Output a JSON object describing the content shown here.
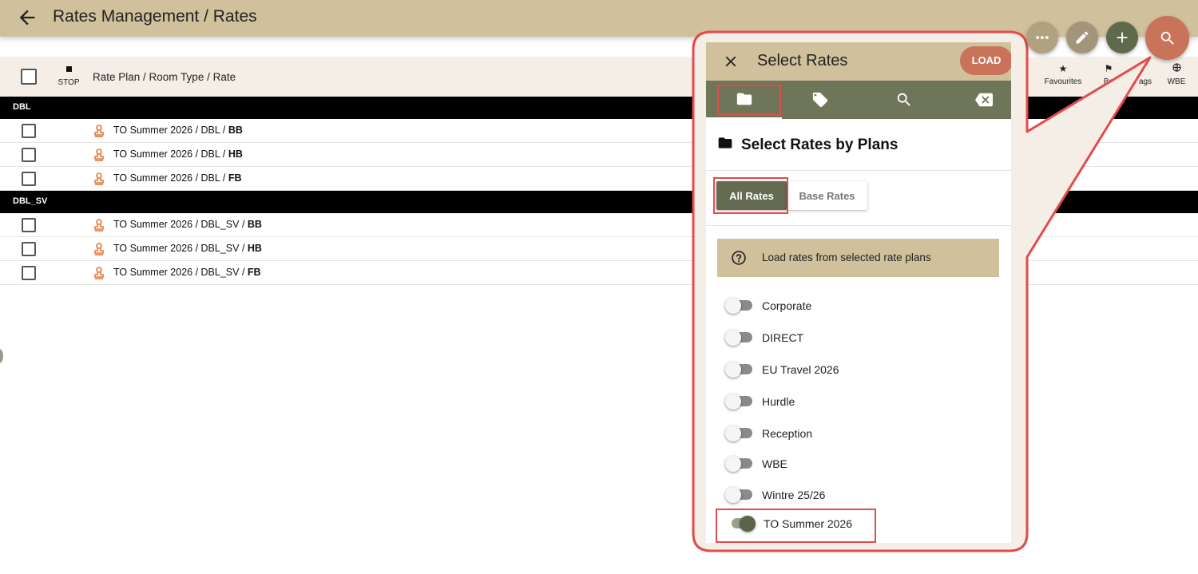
{
  "header": {
    "title": "Rates Management / Rates"
  },
  "table": {
    "stop_label": "STOP",
    "column_label": "Rate Plan / Room Type / Rate",
    "right_columns": [
      {
        "label": "Favourites",
        "icon": "star-icon"
      },
      {
        "label": "Ba",
        "icon": "flag-icon"
      },
      {
        "label": "ags",
        "icon": "tag-icon"
      },
      {
        "label": "WBE",
        "icon": "globe-icon"
      }
    ],
    "groups": [
      {
        "name": "DBL",
        "rows": [
          {
            "path": "TO Summer 2026 / DBL / ",
            "rate": "BB"
          },
          {
            "path": "TO Summer 2026 / DBL / ",
            "rate": "HB"
          },
          {
            "path": "TO Summer 2026 / DBL / ",
            "rate": "FB"
          }
        ]
      },
      {
        "name": "DBL_SV",
        "rows": [
          {
            "path": "TO Summer 2026 / DBL_SV / ",
            "rate": "BB"
          },
          {
            "path": "TO Summer 2026 / DBL_SV / ",
            "rate": "HB"
          },
          {
            "path": "TO Summer 2026 / DBL_SV / ",
            "rate": "FB"
          }
        ]
      }
    ]
  },
  "fabs": [
    {
      "icon": "more-icon",
      "color": "#b1a27f"
    },
    {
      "icon": "edit-icon",
      "color": "#a39579"
    },
    {
      "icon": "add-icon",
      "color": "#5f6a4d"
    },
    {
      "icon": "search-icon",
      "color": "#c9735a"
    }
  ],
  "panel": {
    "title": "Select Rates",
    "load_label": "LOAD",
    "tabs": [
      "folder-icon",
      "tag-icon",
      "search-icon",
      "backspace-icon"
    ],
    "section_title": "Select Rates by Plans",
    "all_rates_label": "All Rates",
    "base_rates_label": "Base Rates",
    "info_text": "Load rates from selected rate plans",
    "plans": [
      {
        "name": "Corporate",
        "on": false
      },
      {
        "name": "DIRECT",
        "on": false
      },
      {
        "name": "EU Travel 2026",
        "on": false
      },
      {
        "name": "Hurdle",
        "on": false
      },
      {
        "name": "Reception",
        "on": false
      },
      {
        "name": "WBE",
        "on": false
      },
      {
        "name": "Wintre 25/26",
        "on": false
      },
      {
        "name": "TO Summer 2026",
        "on": true
      }
    ]
  },
  "colors": {
    "header_bg": "#d0c09c",
    "tabs_bg": "#6f7559",
    "accent": "#c9735a",
    "highlight": "#e34b4b"
  }
}
